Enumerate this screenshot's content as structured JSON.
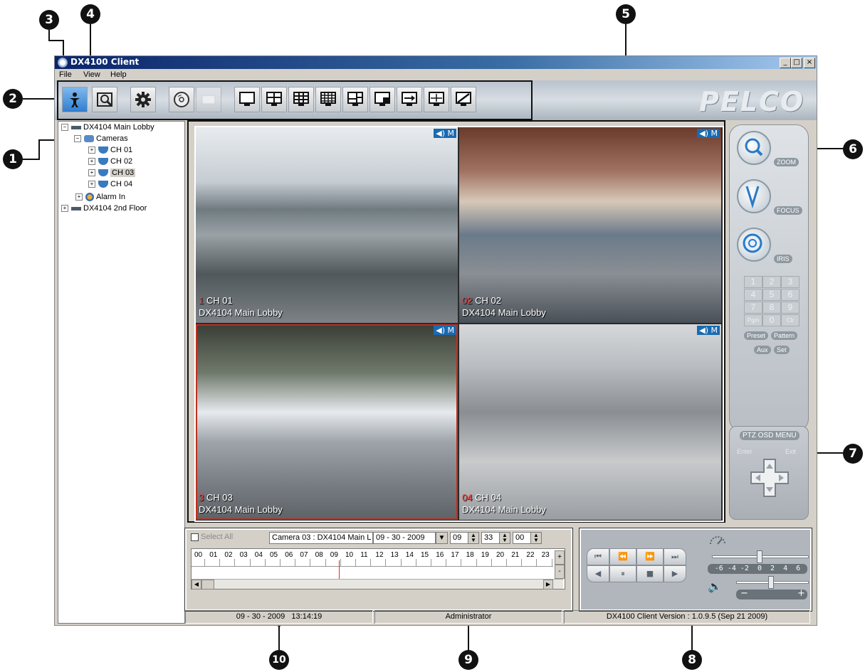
{
  "window": {
    "title": "DX4100 Client"
  },
  "menu": [
    "File",
    "View",
    "Help"
  ],
  "brand": "PELCO",
  "tree": {
    "root1": "DX4104 Main Lobby",
    "cameras": "Cameras",
    "channels": [
      "CH 01",
      "CH 02",
      "CH 03",
      "CH 04"
    ],
    "alarm": "Alarm In",
    "root2": "DX4104 2nd Floor"
  },
  "video": [
    {
      "num": "1",
      "ch": "CH 01",
      "site": "DX4104 Main Lobby",
      "badge": "◀) M"
    },
    {
      "num": "02",
      "ch": "CH 02",
      "site": "DX4104 Main Lobby",
      "badge": "◀) M"
    },
    {
      "num": "3",
      "ch": "CH 03",
      "site": "DX4104 Main Lobby",
      "badge": "◀) M"
    },
    {
      "num": "04",
      "ch": "CH 04",
      "site": "DX4104 Main Lobby",
      "badge": "◀) M"
    }
  ],
  "ptz": {
    "zoom": "ZOOM",
    "focus": "FOCUS",
    "iris": "IRIS",
    "keys": [
      "1",
      "2",
      "3",
      "4",
      "5",
      "6",
      "7",
      "8",
      "9",
      "Pgm",
      "0",
      "Clr"
    ],
    "preset": "Preset",
    "pattern": "Pattern",
    "aux": "Aux",
    "set": "Set",
    "osd_title": "PTZ OSD MENU",
    "enter": "Enter",
    "exit": "Exit"
  },
  "search": {
    "select_all": "Select All",
    "camera": "Camera 03 : DX4104 Main L",
    "date": "09 - 30 - 2009",
    "hour": "09",
    "minute": "33",
    "second": "00",
    "hours": [
      "00",
      "01",
      "02",
      "03",
      "04",
      "05",
      "06",
      "07",
      "08",
      "09",
      "10",
      "11",
      "12",
      "13",
      "14",
      "15",
      "16",
      "17",
      "18",
      "19",
      "20",
      "21",
      "22",
      "23"
    ]
  },
  "playback": {
    "speed_scale": "-6 -4 -2  0  2  4  6",
    "vol_minus": "−",
    "vol_plus": "+"
  },
  "status": {
    "datetime": "09 - 30 - 2009   13:14:19",
    "user": "Administrator",
    "version": "DX4100 Client Version : 1.0.9.5 (Sep 21 2009)"
  },
  "callouts": [
    "1",
    "2",
    "3",
    "4",
    "5",
    "6",
    "7",
    "8",
    "9",
    "10"
  ]
}
